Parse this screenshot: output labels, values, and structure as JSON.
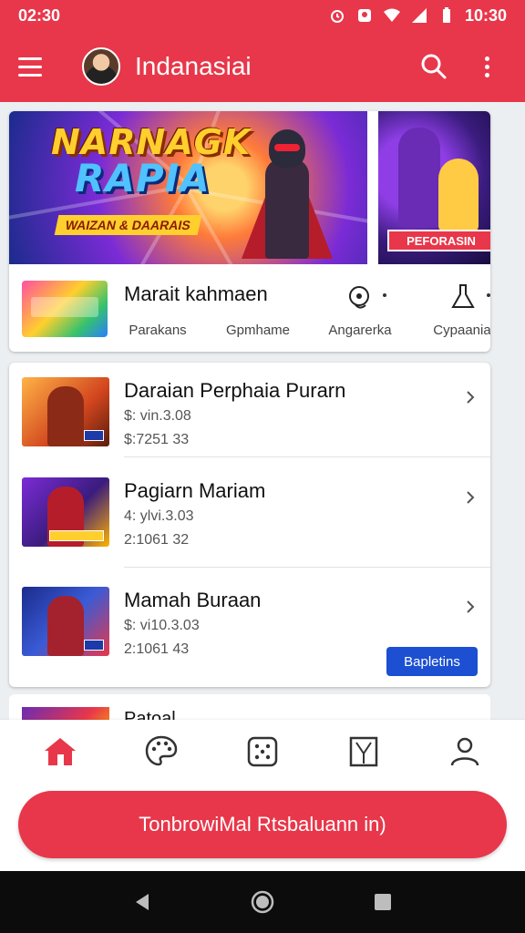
{
  "status_bar": {
    "time": "02:30",
    "right_time": "10:30"
  },
  "app_bar": {
    "title": "Indanasiai"
  },
  "featured": {
    "banner_title_line1": "NARNAGK",
    "banner_title_line2": "RAPIA",
    "banner_subtitle": "WAIZAN & DAARAIS",
    "side_badge": "PEFORASIN",
    "title": "Marait kahmaen",
    "labels": [
      "Parakans",
      "Gpmhame",
      "Angarerka",
      "Cypaania"
    ]
  },
  "list": [
    {
      "title": "Daraian Perphaia Purarn",
      "meta1": "$: vin.3.08",
      "meta2": "$:7251 33"
    },
    {
      "title": "Pagiarn Mariam",
      "meta1": "4: ylvi.3.03",
      "meta2": "2:1061 32"
    },
    {
      "title": "Mamah Buraan",
      "meta1": "$: vi10.3.03",
      "meta2": "2:1061 43",
      "badge": "Bapletins"
    }
  ],
  "peek": {
    "title": "Patoal"
  },
  "bottom_nav": [
    "home-icon",
    "palette-icon",
    "dice-icon",
    "book-icon",
    "profile-icon"
  ],
  "cta": {
    "label": "TonbrowiMal Rtsbaluann in)"
  },
  "colors": {
    "accent": "#e8374a",
    "badge_blue": "#1c4fd1"
  }
}
